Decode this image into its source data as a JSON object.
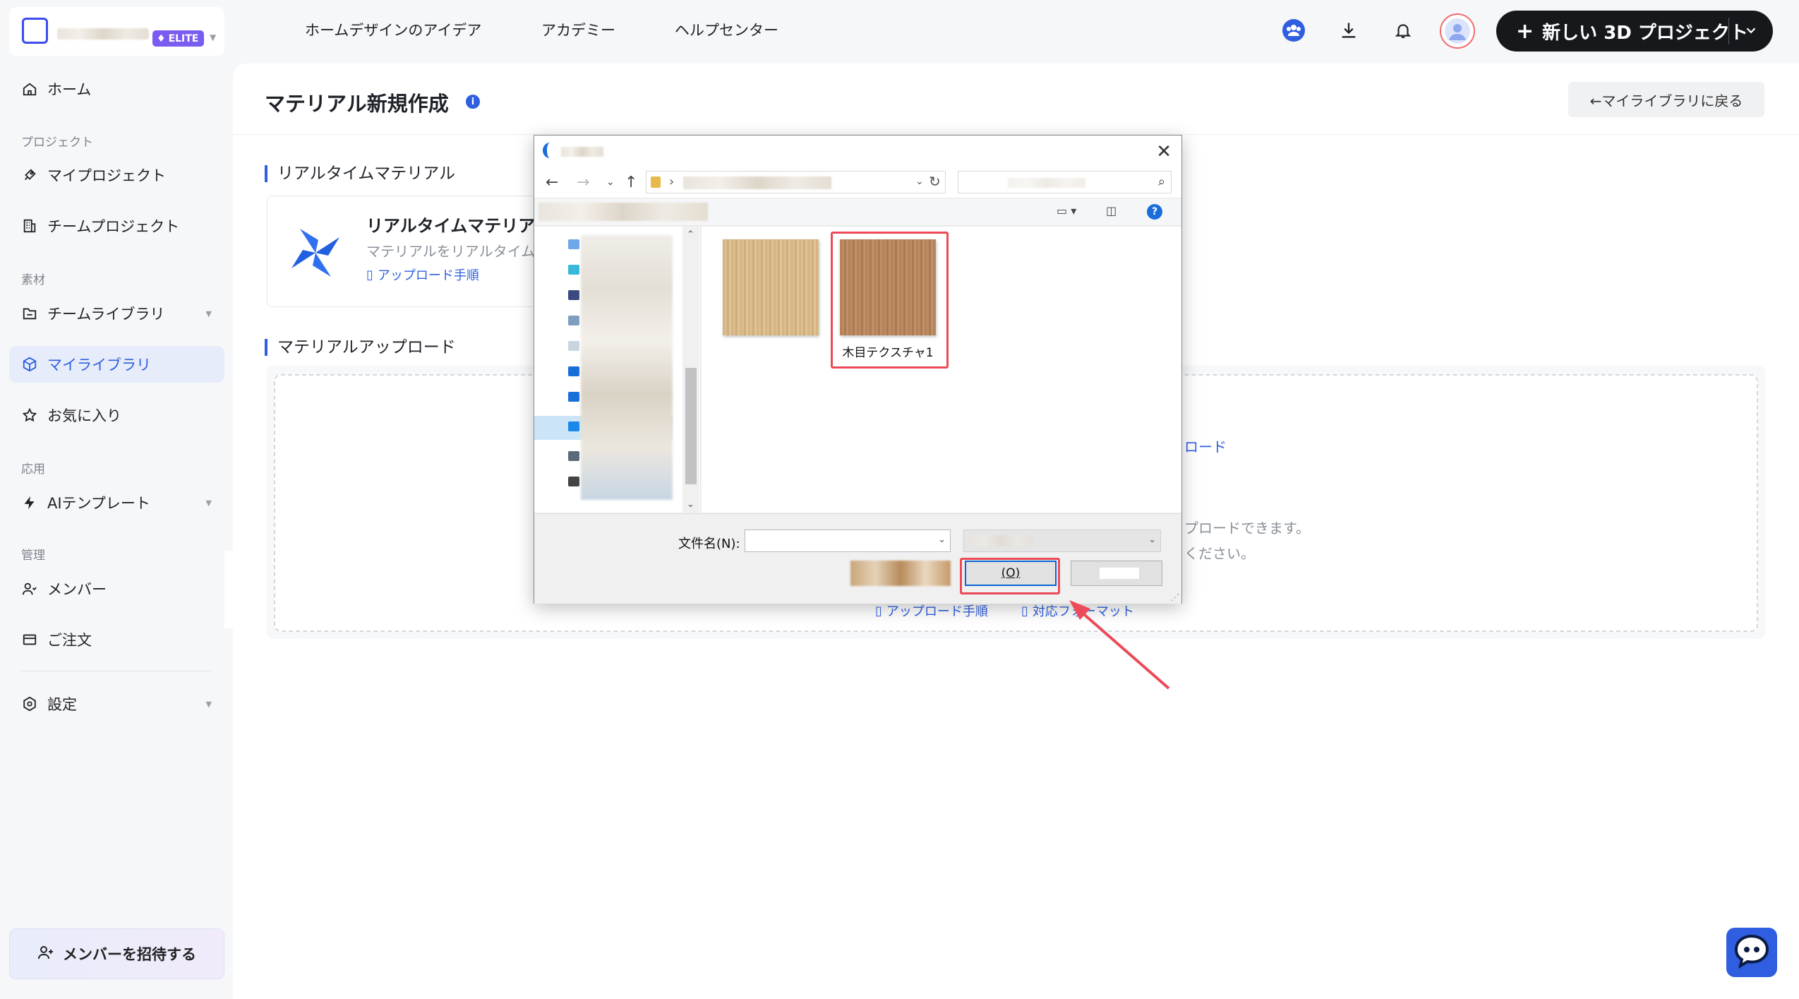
{
  "workspace": {
    "badge": "ELITE"
  },
  "topnav": {
    "items": [
      "ホームデザインのアイデア",
      "アカデミー",
      "ヘルプセンター"
    ],
    "new_project_label": "新しい 3D プロジェクト"
  },
  "sidebar": {
    "home": "ホーム",
    "section_project": "プロジェクト",
    "my_projects": "マイプロジェクト",
    "team_projects": "チームプロジェクト",
    "section_materials": "素材",
    "team_library": "チームライブラリ",
    "my_library": "マイライブラリ",
    "favorites": "お気に入り",
    "section_apps": "応用",
    "ai_templates": "AIテンプレート",
    "section_admin": "管理",
    "members": "メンバー",
    "orders": "ご注文",
    "settings": "設定",
    "invite": "メンバーを招待する"
  },
  "page": {
    "title": "マテリアル新規作成",
    "back_label": "←マイライブラリに戻る",
    "realtime_section": "リアルタイムマテリアル",
    "realtime_card_title": "リアルタイムマテリア",
    "realtime_card_desc": "マテリアルをリアルタイム",
    "realtime_card_link": "アップロード手順",
    "upload_section": "マテリアルアップロード",
    "upload_link_partial": "ロード",
    "upload_hint1_partial": "プロードできます。",
    "upload_hint2_partial": "ください。",
    "upload_guide_link": "アップロード手順",
    "upload_format_link": "対応フォーマット"
  },
  "dialog": {
    "close_symbol": "✕",
    "files": [
      {
        "name": "",
        "texture": "light"
      },
      {
        "name": "木目テクスチャ1",
        "texture": "dark"
      }
    ],
    "filename_label": "文件名(N):",
    "filename_value": "",
    "open_shortcut": "(O)"
  },
  "colors": {
    "accent": "#2f5fe0",
    "highlight": "#ec4a58",
    "elite": "#7b5cf0",
    "primary_button": "#16181c"
  }
}
